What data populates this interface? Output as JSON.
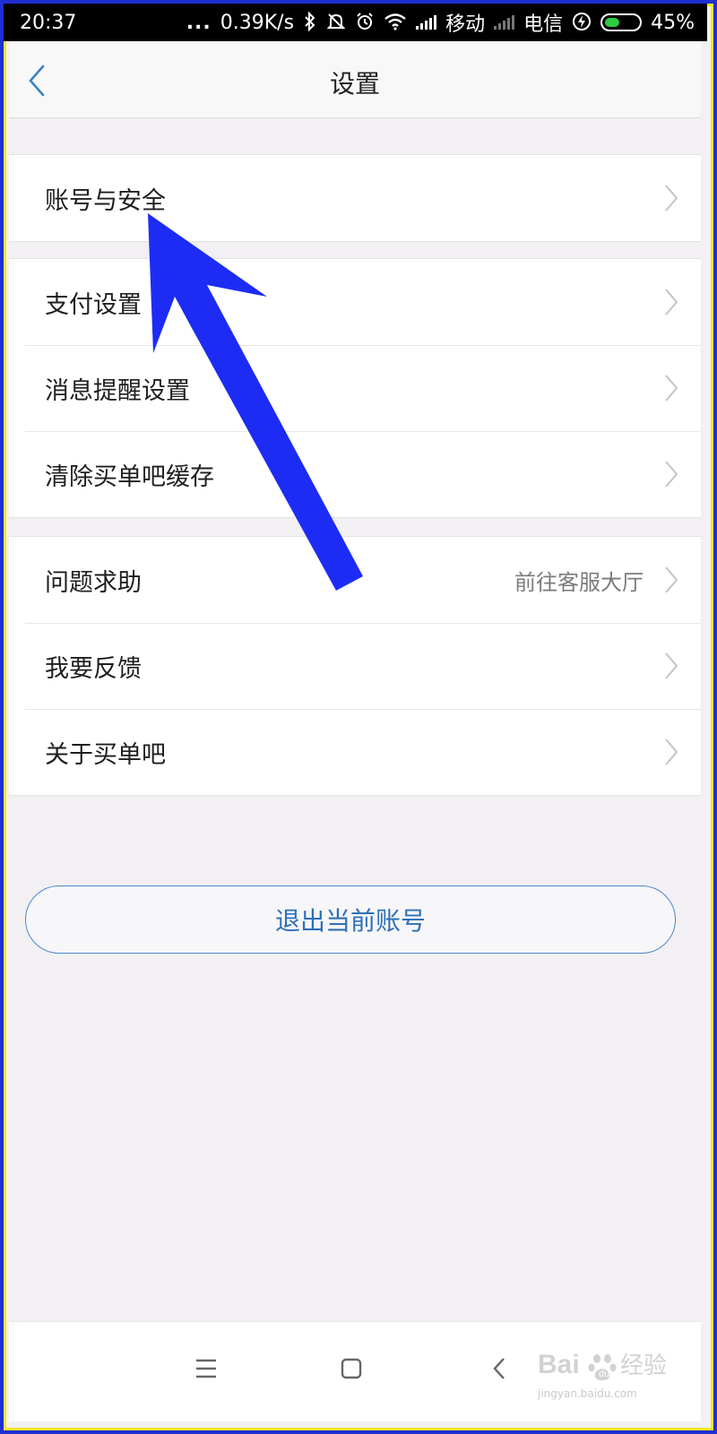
{
  "status_bar": {
    "time": "20:37",
    "dots": "...",
    "speed": "0.39K/s",
    "carrier1": "移动",
    "carrier2": "电信",
    "battery": "45%",
    "battery_level": 0.45,
    "icons": [
      "bluetooth-icon",
      "mute-bell-icon",
      "alarm-icon",
      "wifi-icon",
      "signal-icon",
      "charging-icon",
      "battery-icon"
    ]
  },
  "header": {
    "title": "设置",
    "back_icon": "chevron-left-icon"
  },
  "groups": [
    {
      "items": [
        {
          "label": "账号与安全"
        }
      ]
    },
    {
      "items": [
        {
          "label": "支付设置"
        },
        {
          "label": "消息提醒设置"
        },
        {
          "label": "清除买单吧缓存"
        }
      ]
    },
    {
      "items": [
        {
          "label": "问题求助",
          "hint": "前往客服大厅"
        },
        {
          "label": "我要反馈"
        },
        {
          "label": "关于买单吧"
        }
      ]
    }
  ],
  "logout_label": "退出当前账号",
  "system_nav": {
    "icons": [
      "menu-icon",
      "home-icon",
      "back-icon"
    ]
  },
  "watermark": {
    "brand": "Bai du 经验",
    "url": "jingyan.baidu.com"
  },
  "colors": {
    "accent": "#2e70b8",
    "annotation_arrow": "#1d2cf5",
    "frame_outer": "#1f2fd0",
    "frame_inner": "#f0e62a",
    "background": "#f2f0f3"
  }
}
